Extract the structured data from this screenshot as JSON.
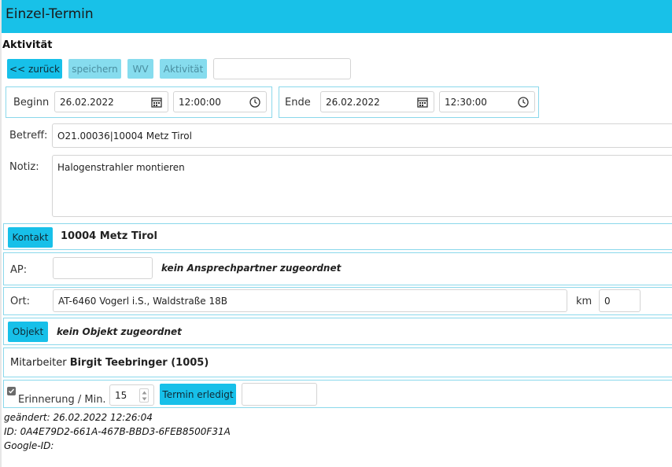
{
  "header": {
    "title": "Einzel-Termin"
  },
  "section": {
    "title": "Aktivität"
  },
  "toolbar": {
    "back_label": "<< zurück",
    "save_label": "speichern",
    "wv_label": "WV",
    "activity_label": "Aktivität",
    "extra_input_value": ""
  },
  "begin": {
    "label": "Beginn",
    "date": "26.02.2022",
    "time": "12:00:00"
  },
  "end": {
    "label": "Ende",
    "date": "26.02.2022",
    "time": "12:30:00"
  },
  "subject": {
    "label": "Betreff:",
    "value": "O21.00036|10004 Metz Tirol"
  },
  "note": {
    "label": "Notiz:",
    "value": "Halogenstrahler montieren"
  },
  "contact": {
    "button_label": "Kontakt",
    "name": "10004 Metz Tirol"
  },
  "ap": {
    "label": "AP:",
    "value": "",
    "note": "kein Ansprechpartner zugeordnet"
  },
  "location": {
    "label": "Ort:",
    "value": "AT-6460 Vogerl i.S., Waldstraße 18B",
    "km_label": "km",
    "km_value": "0"
  },
  "object": {
    "button_label": "Objekt",
    "note": "kein Objekt zugeordnet"
  },
  "employee": {
    "label": "Mitarbeiter",
    "name": "Birgit Teebringer (1005)"
  },
  "reminder": {
    "checked": true,
    "label": "Erinnerung / Min.",
    "minutes": "15",
    "done_label": "Termin erledigt",
    "extra_value": ""
  },
  "meta": {
    "changed": "geändert: 26.02.2022 12:26:04",
    "id": "ID: 0A4E79D2-661A-467B-BBD3-6FEB8500F31A",
    "google_id": "Google-ID:"
  },
  "colors": {
    "accent": "#17c0e9",
    "accent_disabled": "#86dcee",
    "panel_border": "#8bd8eb"
  }
}
